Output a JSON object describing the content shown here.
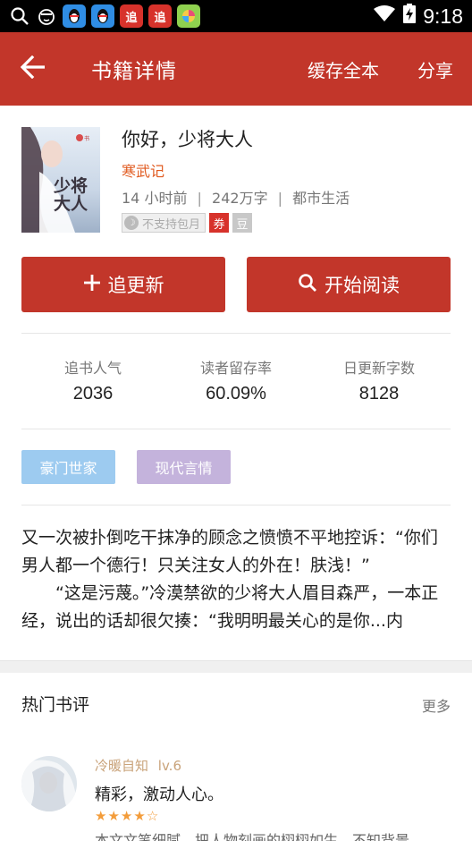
{
  "status_bar": {
    "time": "9:18",
    "app_icons": [
      {
        "name": "search-icon"
      },
      {
        "name": "sticker-face-icon"
      },
      {
        "name": "qq-penguin-icon",
        "color": "#2f8de4"
      },
      {
        "name": "qq-penguin-icon",
        "color": "#2f8de4"
      },
      {
        "name": "zhui-app-icon",
        "label": "追",
        "color": "#d7322b"
      },
      {
        "name": "zhui-app-icon",
        "label": "追",
        "color": "#d7322b"
      },
      {
        "name": "game-app-icon",
        "color": "#8fd14f"
      }
    ]
  },
  "top_bar": {
    "title": "书籍详情",
    "cache_all": "缓存全本",
    "share": "分享",
    "color": "#c2362a"
  },
  "book": {
    "title": "你好，少将大人",
    "author": "寒武记",
    "updated": "14 小时前",
    "word_count": "242万字",
    "genre": "都市生活",
    "meta_separator": "|",
    "monthly_tag": "不支持包月",
    "coupon_tag": "券",
    "bean_tag": "豆",
    "cover_text": "少将大人"
  },
  "buttons": {
    "follow_label": "追更新",
    "read_label": "开始阅读"
  },
  "stats": [
    {
      "label": "追书人气",
      "value": "2036"
    },
    {
      "label": "读者留存率",
      "value": "60.09%"
    },
    {
      "label": "日更新字数",
      "value": "8128"
    }
  ],
  "categories": [
    {
      "label": "豪门世家",
      "color": "#9dcbf0"
    },
    {
      "label": "现代言情",
      "color": "#c4b3dc"
    }
  ],
  "description": "又一次被扑倒吃干抹净的顾念之愤愤不平地控诉：“你们男人都一个德行！只关注女人的外在！肤浅！”\n　　“这是污蔑。”冷漠禁欲的少将大人眉目森严，一本正经，说出的话却很欠揍：“我明明最关心的是你...内",
  "reviews": {
    "section_title": "热门书评",
    "more": "更多",
    "items": [
      {
        "user": "冷暖自知",
        "level": "lv.6",
        "title": "精彩，激动人心。",
        "rating": 4,
        "max_rating": 5,
        "body": "本文文笔细腻，把人物刻画的栩栩如生。不知背景"
      }
    ]
  }
}
